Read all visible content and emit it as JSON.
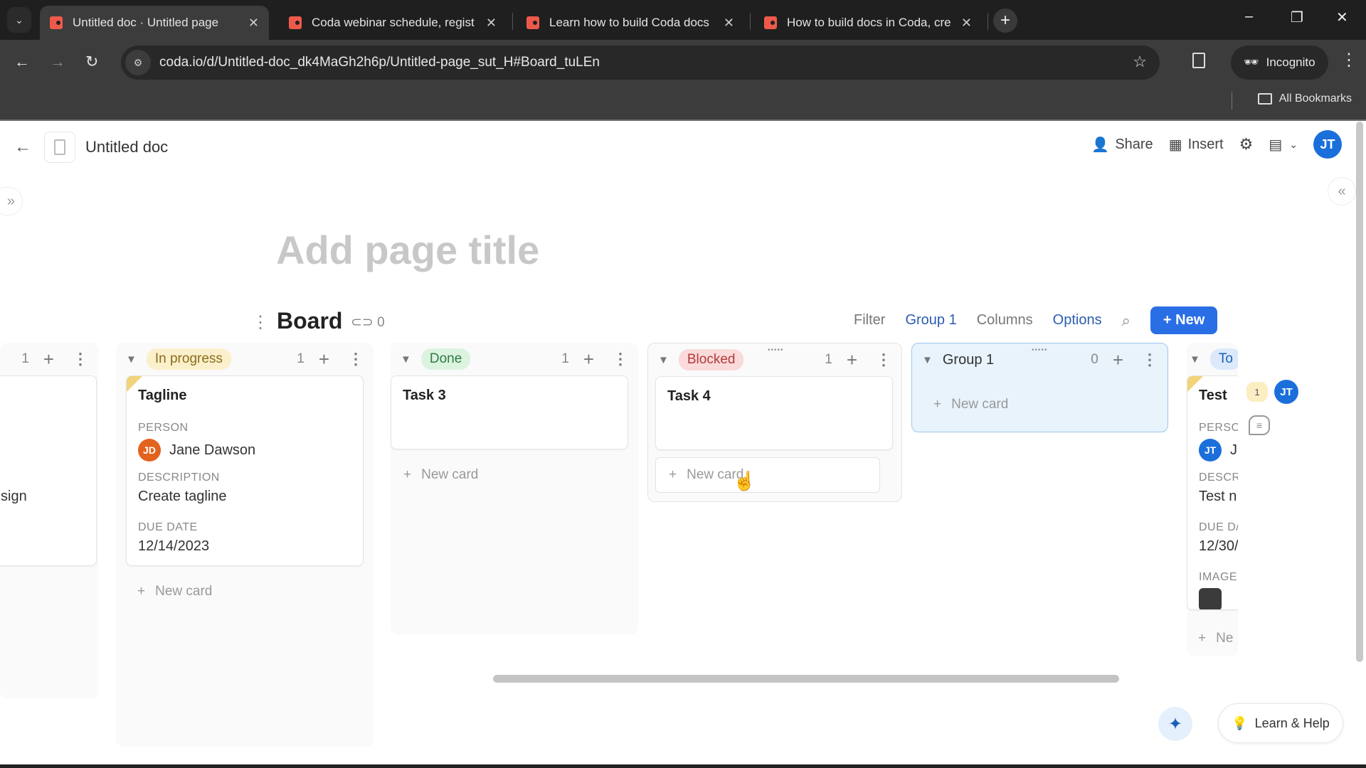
{
  "browser": {
    "tabs": [
      {
        "title": "Untitled doc · Untitled page",
        "active": true
      },
      {
        "title": "Coda webinar schedule, regist",
        "active": false
      },
      {
        "title": "Learn how to build Coda docs",
        "active": false
      },
      {
        "title": "How to build docs in Coda, cre",
        "active": false
      }
    ],
    "url": "coda.io/d/Untitled-doc_dk4MaGh2h6p/Untitled-page_sut_H#Board_tuLEn",
    "profile_label": "Incognito",
    "bookmarks_label": "All Bookmarks",
    "icons": {
      "tab_menu": "chevron-down-icon",
      "close": "✕",
      "new_tab": "+",
      "back": "←",
      "forward": "→",
      "reload": "↻",
      "star": "☆",
      "minimize": "–",
      "restore": "❐",
      "win_close": "✕",
      "kebab": "⋮"
    }
  },
  "doc": {
    "title": "Untitled doc",
    "header_actions": {
      "share": "Share",
      "insert": "Insert",
      "user_initials": "JT"
    },
    "page_title_placeholder": "Add page title"
  },
  "board": {
    "title": "Board",
    "link_count": "0",
    "tools": {
      "filter": "Filter",
      "group": "Group 1",
      "columns": "Columns",
      "options": "Options",
      "new": "New"
    },
    "columns": [
      {
        "label": "",
        "count": "1",
        "partial": true,
        "cards": [
          {
            "description_fragment": "sign"
          }
        ]
      },
      {
        "label": "In progress",
        "pill_bg": "#fbf0cc",
        "pill_fg": "#8a6d1a",
        "count": "1",
        "cards": [
          {
            "title": "Tagline",
            "person_label": "PERSON",
            "person_initials": "JD",
            "person_name": "Jane Dawson",
            "person_color": "#e3621e",
            "description_label": "DESCRIPTION",
            "description": "Create tagline",
            "due_label": "DUE DATE",
            "due": "12/14/2023"
          }
        ],
        "new_card": "New card"
      },
      {
        "label": "Done",
        "pill_bg": "#dcf3e0",
        "pill_fg": "#2e7d43",
        "count": "1",
        "cards": [
          {
            "title": "Task 3"
          }
        ],
        "new_card": "New card"
      },
      {
        "label": "Blocked",
        "pill_bg": "#fadada",
        "pill_fg": "#b23a3a",
        "count": "1",
        "cards": [
          {
            "title": "Task 4"
          }
        ],
        "new_card": "New card"
      },
      {
        "label": "Group 1",
        "count": "0",
        "cards": [],
        "new_card": "New card"
      },
      {
        "label": "To",
        "pill_bg": "#dbe9fb",
        "pill_fg": "#1c5fb8",
        "partial": true,
        "cards": [
          {
            "title": "Test",
            "person_label": "PERSO",
            "person_initials": "JT",
            "person_name": "J",
            "description_label": "DESCR",
            "description": "Test n",
            "due_label": "DUE D/",
            "due": "12/30/",
            "image_label": "IMAGE"
          }
        ],
        "new_card": "Ne"
      }
    ],
    "comment_count": "1",
    "commenter_initials": "JT"
  },
  "footer": {
    "learn_help": "Learn & Help"
  },
  "colors": {
    "accent": "#2a6ee6",
    "link": "#2a5db0",
    "avatar_blue": "#1b6fdb",
    "coda_red": "#ee5a4a"
  }
}
